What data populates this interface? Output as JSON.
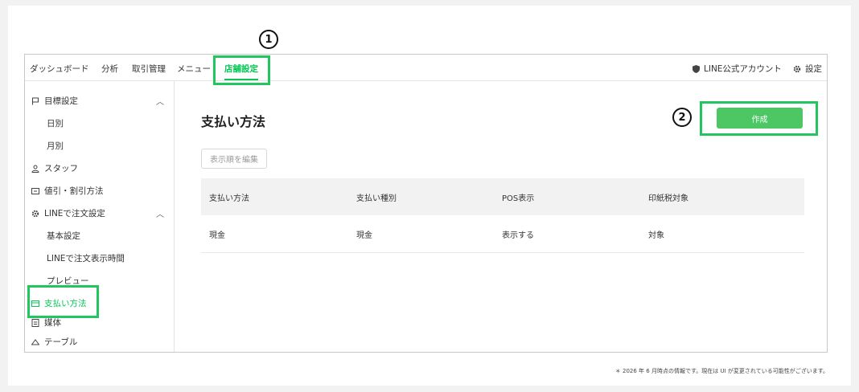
{
  "topnav": {
    "items": [
      {
        "label": "ダッシュボード",
        "active": false
      },
      {
        "label": "分析",
        "active": false
      },
      {
        "label": "取引管理",
        "active": false
      },
      {
        "label": "メニュー",
        "active": false
      },
      {
        "label": "店舗設定",
        "active": true
      }
    ],
    "line_account": "LINE公式アカウント",
    "settings": "設定"
  },
  "sidebar": {
    "goal": "目標設定",
    "goal_daily": "日別",
    "goal_monthly": "月別",
    "staff": "スタッフ",
    "discount": "値引・割引方法",
    "line_order": "LINEで注文設定",
    "basic": "基本設定",
    "line_time": "LINEで注文表示時間",
    "preview": "プレビュー",
    "payment": "支払い方法",
    "media": "媒体",
    "table": "テーブル"
  },
  "main": {
    "title": "支払い方法",
    "create_button": "作成",
    "edit_order_button": "表示順を編集",
    "columns": [
      "支払い方法",
      "支払い種別",
      "POS表示",
      "印紙税対象"
    ],
    "rows": [
      [
        "現金",
        "現金",
        "表示する",
        "対象"
      ]
    ]
  },
  "annotations": {
    "step1": "1",
    "step2": "2"
  },
  "footnote": "＊ 2026 年 6 月時点の情報です。現在は UI が変更されている可能性がございます。",
  "colors": {
    "accent": "#06c755",
    "button": "#4cc764",
    "highlight": "#22c55e"
  }
}
